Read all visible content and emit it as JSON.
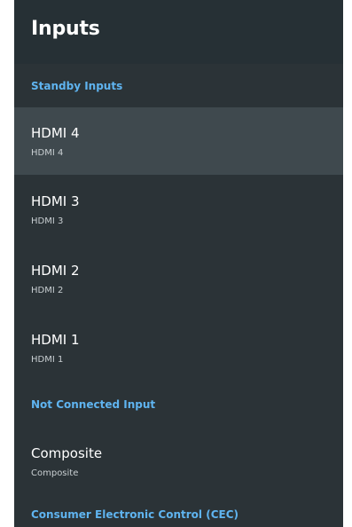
{
  "header": {
    "title": "Inputs"
  },
  "sections": {
    "standby": {
      "label": "Standby Inputs"
    },
    "not_connected": {
      "label": "Not Connected Input"
    },
    "cec": {
      "label": "Consumer Electronic Control (CEC)"
    }
  },
  "inputs": [
    {
      "title": "HDMI 4",
      "subtitle": "HDMI 4",
      "selected": true
    },
    {
      "title": "HDMI 3",
      "subtitle": "HDMI 3"
    },
    {
      "title": "HDMI 2",
      "subtitle": "HDMI 2"
    },
    {
      "title": "HDMI 1",
      "subtitle": "HDMI 1"
    }
  ],
  "not_connected_inputs": [
    {
      "title": "Composite",
      "subtitle": "Composite"
    }
  ],
  "colors": {
    "panel_bg": "#2b3337",
    "header_bg": "#263035",
    "selected_bg": "#3f494e",
    "section_text": "#5fb4f0"
  }
}
